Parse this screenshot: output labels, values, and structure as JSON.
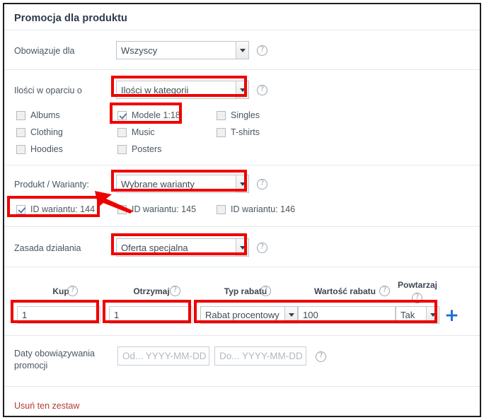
{
  "panel": {
    "title": "Promocja dla produktu"
  },
  "rows": {
    "applies_to": {
      "label": "Obowiązuje dla",
      "select_value": "Wszyscy",
      "help": "?"
    },
    "quantities_based_on": {
      "label": "Ilości w oparciu o",
      "select_value": "Ilości w kategorii",
      "help": "?"
    },
    "product_variants": {
      "label": "Produkt / Warianty:",
      "select_value": "Wybrane warianty",
      "help": "?"
    },
    "action_rule": {
      "label": "Zasada działania",
      "select_value": "Oferta specjalna",
      "help": "?"
    },
    "dates": {
      "label": "Daty obowiązywania promocji",
      "from_placeholder": "Od... YYYY-MM-DD",
      "to_placeholder": "Do... YYYY-MM-DD",
      "from_value": "",
      "to_value": "",
      "help": "?"
    }
  },
  "categories": [
    {
      "label": "Albums",
      "checked": false
    },
    {
      "label": "Clothing",
      "checked": false
    },
    {
      "label": "Hoodies",
      "checked": false
    },
    {
      "label": "Modele 1:18",
      "checked": true
    },
    {
      "label": "Music",
      "checked": false
    },
    {
      "label": "Posters",
      "checked": false
    },
    {
      "label": "Singles",
      "checked": false
    },
    {
      "label": "T-shirts",
      "checked": false
    }
  ],
  "variants": [
    {
      "label": "ID wariantu: 144",
      "checked": true
    },
    {
      "label": "ID wariantu: 145",
      "checked": false
    },
    {
      "label": "ID wariantu: 146",
      "checked": false
    }
  ],
  "promo_table": {
    "headers": {
      "buy": "Kup",
      "get": "Otrzymaj",
      "discount_type": "Typ rabatu",
      "discount_value": "Wartość rabatu",
      "repeat": "Powtarzaj"
    },
    "help": "?",
    "values": {
      "buy": "1",
      "get": "1",
      "discount_type": "Rabat procentowy",
      "discount_value": "100",
      "repeat": "Tak"
    },
    "add_button": "+"
  },
  "footer": {
    "delete_link": "Usuń ten zestaw"
  },
  "colors": {
    "annotation": "#ef0000",
    "add_button": "#1a6fd4",
    "danger_link": "#b33c34",
    "title": "#2b3a4a"
  }
}
